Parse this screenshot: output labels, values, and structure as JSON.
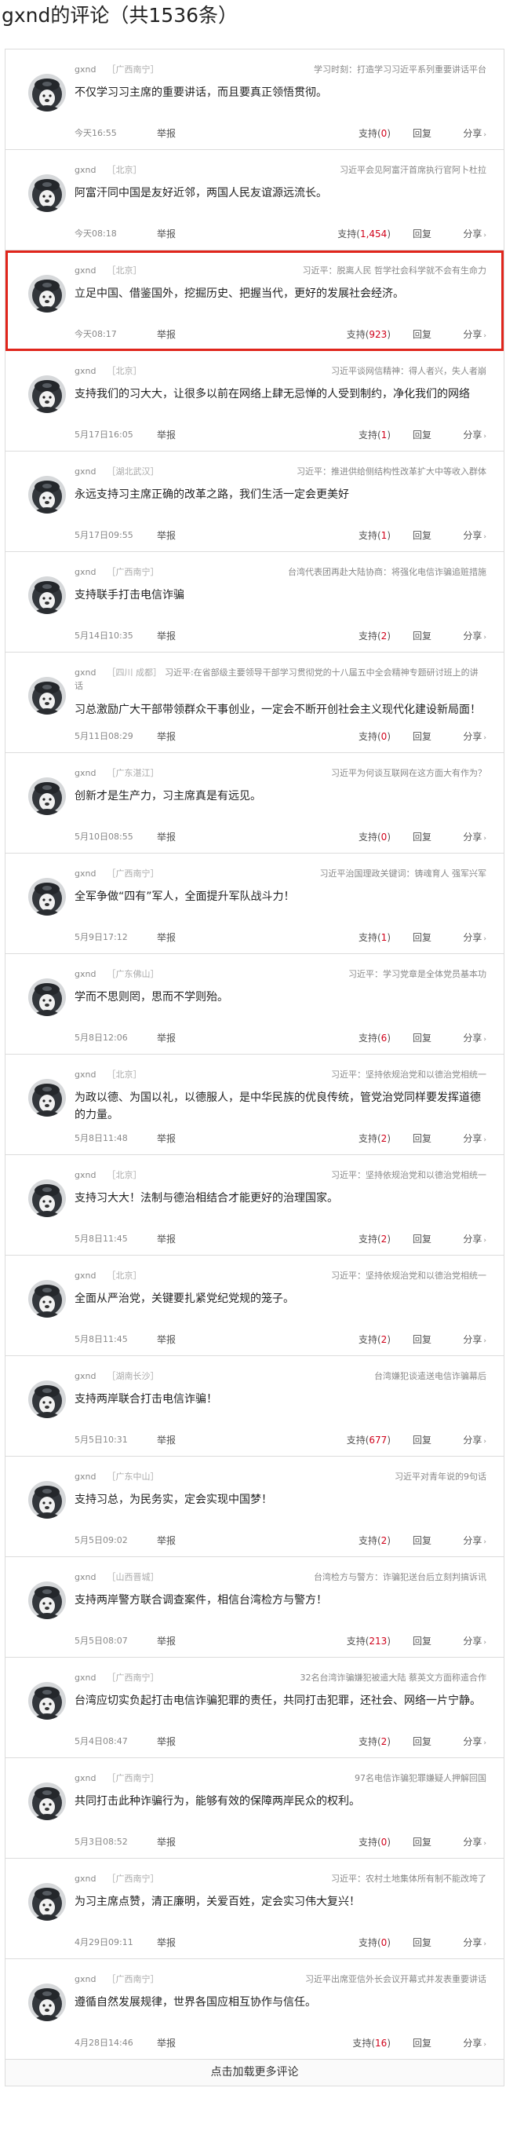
{
  "header": {
    "title": "gxnd的评论（共1536条）"
  },
  "labels": {
    "report": "举报",
    "support": "支持",
    "reply": "回复",
    "share": "分享",
    "share_arrow": "›",
    "load_more": "点击加载更多评论"
  },
  "colors": {
    "highlight": "#e0251b",
    "count": "#d0021b",
    "border": "#dcdcdc"
  },
  "comments": [
    {
      "user": "gxnd",
      "location": "［广西南宁］",
      "topic": "学习时刻：打造学习习近平系列重要讲话平台",
      "content": "不仅学习习主席的重要讲话，而且要真正领悟贯彻。",
      "time": "今天16:55",
      "support_count": "0"
    },
    {
      "user": "gxnd",
      "location": "［北京］",
      "topic": "习近平会见阿富汗首席执行官阿卜杜拉",
      "content": "阿富汗同中国是友好近邻，两国人民友谊源远流长。",
      "time": "今天08:18",
      "support_count": "1,454"
    },
    {
      "user": "gxnd",
      "location": "［北京］",
      "topic": "习近平：脱离人民 哲学社会科学就不会有生命力",
      "content": "立足中国、借鉴国外，挖掘历史、把握当代，更好的发展社会经济。",
      "time": "今天08:17",
      "support_count": "923"
    },
    {
      "user": "gxnd",
      "location": "［北京］",
      "topic": "习近平谈网信精神：得人者兴，失人者崩",
      "content": "支持我们的习大大，让很多以前在网络上肆无忌惮的人受到制约，净化我们的网络",
      "time": "5月17日16:05",
      "support_count": "1"
    },
    {
      "user": "gxnd",
      "location": "［湖北武汉］",
      "topic": "习近平：推进供给侧结构性改革扩大中等收入群体",
      "content": "永远支持习主席正确的改革之路，我们生活一定会更美好",
      "time": "5月17日09:55",
      "support_count": "1"
    },
    {
      "user": "gxnd",
      "location": "［广西南宁］",
      "topic": "台湾代表团再赴大陆协商：将强化电信诈骗追赃措施",
      "content": "支持联手打击电信诈骗",
      "time": "5月14日10:35",
      "support_count": "2"
    },
    {
      "user": "gxnd",
      "location": "［四川 成都］",
      "topic": "习近平:在省部级主要领导干部学习贯彻党的十八届五中全会精神专题研讨班上的讲话",
      "content": "习总激励广大干部带领群众干事创业，一定会不断开创社会主义现代化建设新局面！",
      "time": "5月11日08:29",
      "support_count": "0"
    },
    {
      "user": "gxnd",
      "location": "［广东湛江］",
      "topic": "习近平为何谈互联网在这方面大有作为？",
      "content": "创新才是生产力，习主席真是有远见。",
      "time": "5月10日08:55",
      "support_count": "0"
    },
    {
      "user": "gxnd",
      "location": "［广西南宁］",
      "topic": "习近平治国理政关键词：铸魂育人 强军兴军",
      "content": "全军争做“四有”军人，全面提升军队战斗力！",
      "time": "5月9日17:12",
      "support_count": "1"
    },
    {
      "user": "gxnd",
      "location": "［广东佛山］",
      "topic": "习近平：学习党章是全体党员基本功",
      "content": "学而不思则罔，思而不学则殆。",
      "time": "5月8日12:06",
      "support_count": "6"
    },
    {
      "user": "gxnd",
      "location": "［北京］",
      "topic": "习近平：坚持依规治党和以德治党相统一",
      "content": "为政以德、为国以礼，以德服人，是中华民族的优良传统，管党治党同样要发挥道德的力量。",
      "time": "5月8日11:48",
      "support_count": "2"
    },
    {
      "user": "gxnd",
      "location": "［北京］",
      "topic": "习近平：坚持依规治党和以德治党相统一",
      "content": "支持习大大！法制与德治相结合才能更好的治理国家。",
      "time": "5月8日11:45",
      "support_count": "2"
    },
    {
      "user": "gxnd",
      "location": "［北京］",
      "topic": "习近平：坚持依规治党和以德治党相统一",
      "content": "全面从严治党，关键要扎紧党纪党规的笼子。",
      "time": "5月8日11:45",
      "support_count": "2"
    },
    {
      "user": "gxnd",
      "location": "［湖南长沙］",
      "topic": "台湾嫌犯谈遣送电信诈骗幕后",
      "content": "支持两岸联合打击电信诈骗！",
      "time": "5月5日10:31",
      "support_count": "677"
    },
    {
      "user": "gxnd",
      "location": "［广东中山］",
      "topic": "习近平对青年说的9句话",
      "content": "支持习总，为民务实，定会实现中国梦！",
      "time": "5月5日09:02",
      "support_count": "2"
    },
    {
      "user": "gxnd",
      "location": "［山西晋城］",
      "topic": "台湾检方与警方：诈骗犯送台后立刻判搞诉讯",
      "content": "支持两岸警方联合调查案件，相信台湾检方与警方！",
      "time": "5月5日08:07",
      "support_count": "213"
    },
    {
      "user": "gxnd",
      "location": "［广西南宁］",
      "topic": "32名台湾诈骗嫌犯被遣大陆 蔡英文方面称遣合作",
      "content": "台湾应切实负起打击电信诈骗犯罪的责任，共同打击犯罪，还社会、网络一片宁静。",
      "time": "5月4日08:47",
      "support_count": "2"
    },
    {
      "user": "gxnd",
      "location": "［广西南宁］",
      "topic": "97名电信诈骗犯罪嫌疑人押解回国",
      "content": "共同打击此种诈骗行为，能够有效的保障两岸民众的权利。",
      "time": "5月3日08:52",
      "support_count": "0"
    },
    {
      "user": "gxnd",
      "location": "［广西南宁］",
      "topic": "习近平：农村土地集体所有制不能改垮了",
      "content": "为习主席点赞，清正廉明，关爱百姓，定会实习伟大复兴！",
      "time": "4月29日09:11",
      "support_count": "0"
    },
    {
      "user": "gxnd",
      "location": "［广西南宁］",
      "topic": "习近平出席亚信外长会议开幕式并发表重要讲话",
      "content": "遵循自然发展规律，世界各国应相互协作与信任。",
      "time": "4月28日14:46",
      "support_count": "16"
    }
  ]
}
